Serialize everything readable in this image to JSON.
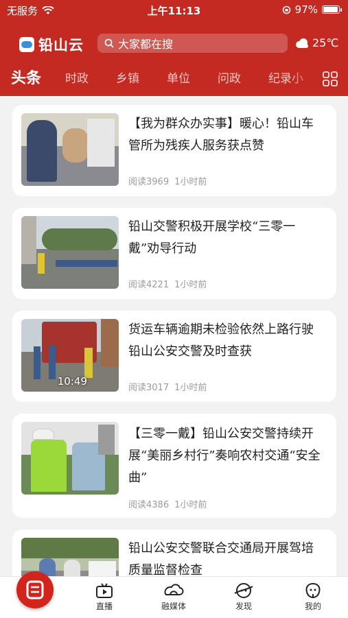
{
  "status": {
    "carrier": "无服务",
    "time": "上午11:13",
    "battery": "97%",
    "battery_level": 0.97
  },
  "app": {
    "name": "铅山云"
  },
  "search": {
    "placeholder": "大家都在搜"
  },
  "weather": {
    "temp": "25℃",
    "icon": "cloud-icon"
  },
  "tabs": [
    "头条",
    "时政",
    "乡镇",
    "单位",
    "问政",
    "纪录小"
  ],
  "articles": [
    {
      "title": "【我为群众办实事】暖心！铅山车管所为残疾人服务获点赞",
      "reads": "阅读3969",
      "time": "1小时前"
    },
    {
      "title": "铅山交警积极开展学校“三零一戴”劝导行动",
      "reads": "阅读4221",
      "time": "1小时前"
    },
    {
      "title": "货运车辆逾期未检验依然上路行驶 铅山公安交警及时查获",
      "reads": "阅读3017",
      "time": "1小时前",
      "duration": "10:49"
    },
    {
      "title": "【三零一戴】铅山公安交警持续开展“美丽乡村行”奏响农村交通“安全曲”",
      "reads": "阅读4386",
      "time": "1小时前"
    },
    {
      "title": "铅山公安交警联合交通局开展驾培质量监督检查",
      "reads": "",
      "time": ""
    }
  ],
  "bottom_nav": [
    {
      "label": "直播",
      "icon": "tv-icon"
    },
    {
      "label": "融媒体",
      "icon": "media-icon"
    },
    {
      "label": "发现",
      "icon": "discover-icon"
    },
    {
      "label": "我的",
      "icon": "profile-icon"
    }
  ],
  "colors": {
    "brand": "#c52a22",
    "home_button": "#d3231d",
    "meta_text": "#9a9a9a"
  }
}
